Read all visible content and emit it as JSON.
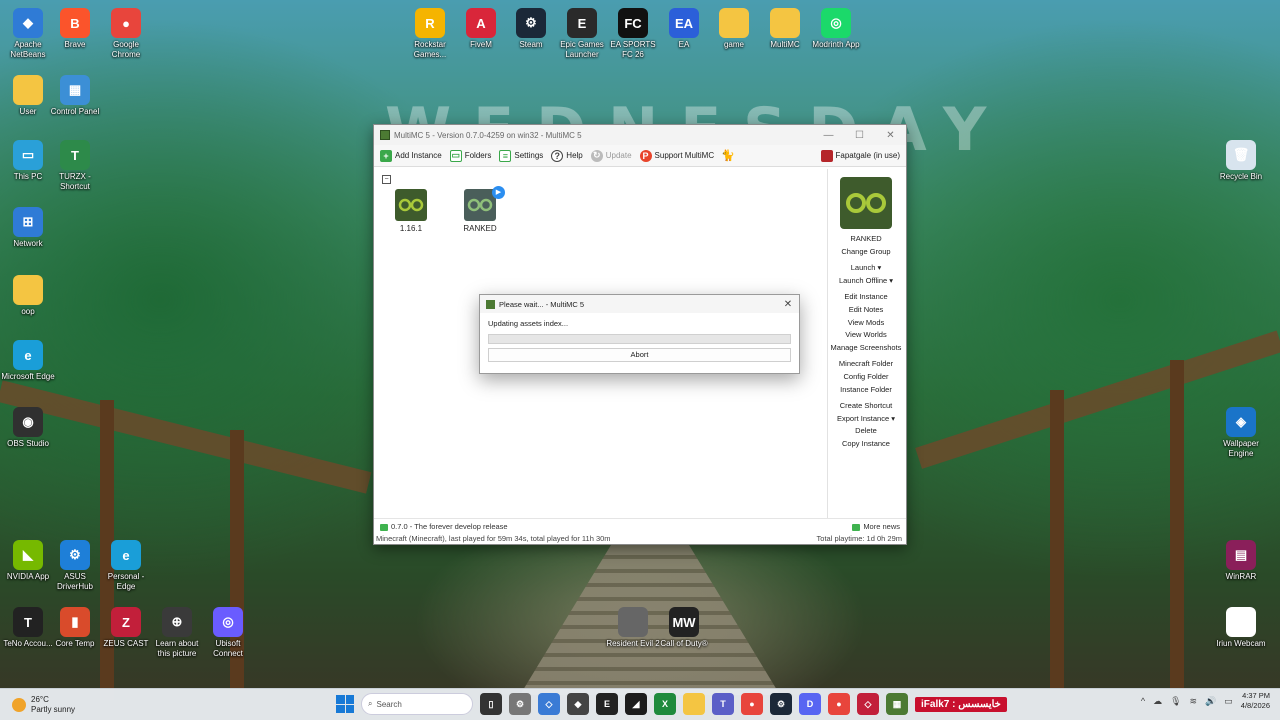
{
  "wallpaper": {
    "text": "WEDNESDAY"
  },
  "desktop_icons": [
    {
      "label": "Apache NetBeans",
      "color": "#2f7bd6",
      "glyph": "◆"
    },
    {
      "label": "Brave",
      "color": "#fb542b",
      "glyph": "B"
    },
    {
      "label": "Google Chrome",
      "color": "#e8453c",
      "glyph": "●"
    },
    {
      "label": "User",
      "color": "#f4c542",
      "glyph": ""
    },
    {
      "label": "Control Panel",
      "color": "#3c8fd6",
      "glyph": "▦"
    },
    {
      "label": "This PC",
      "color": "#2aa0d8",
      "glyph": "▭"
    },
    {
      "label": "TURZX - Shortcut",
      "color": "#2d8a4a",
      "glyph": "T"
    },
    {
      "label": "Network",
      "color": "#2f7bd6",
      "glyph": "⊞"
    },
    {
      "label": "oop",
      "color": "#f4c542",
      "glyph": ""
    },
    {
      "label": "Microsoft Edge",
      "color": "#1a9ed8",
      "glyph": "e"
    },
    {
      "label": "OBS Studio",
      "color": "#303030",
      "glyph": "◉"
    },
    {
      "label": "Rockstar Games...",
      "color": "#f5b400",
      "glyph": "R"
    },
    {
      "label": "FiveM",
      "color": "#d9263a",
      "glyph": "A"
    },
    {
      "label": "Steam",
      "color": "#1b2838",
      "glyph": "⚙"
    },
    {
      "label": "Epic Games Launcher",
      "color": "#2a2a2a",
      "glyph": "E"
    },
    {
      "label": "EA SPORTS FC 26",
      "color": "#111111",
      "glyph": "FC"
    },
    {
      "label": "EA",
      "color": "#2b5fd9",
      "glyph": "EA"
    },
    {
      "label": "game",
      "color": "#f4c542",
      "glyph": ""
    },
    {
      "label": "MultiMC",
      "color": "#f4c542",
      "glyph": ""
    },
    {
      "label": "Modrinth App",
      "color": "#1bd96a",
      "glyph": "◎"
    },
    {
      "label": "Recycle Bin",
      "color": "#d8e4ee",
      "glyph": "🗑"
    },
    {
      "label": "Wallpaper Engine",
      "color": "#1a74c9",
      "glyph": "◈"
    },
    {
      "label": "NVIDIA App",
      "color": "#76b900",
      "glyph": "◣"
    },
    {
      "label": "ASUS DriverHub",
      "color": "#1e7fd8",
      "glyph": "⚙"
    },
    {
      "label": "Personal - Edge",
      "color": "#1a9ed8",
      "glyph": "e"
    },
    {
      "label": "TeNo Accou...",
      "color": "#222222",
      "glyph": "T"
    },
    {
      "label": "Core Temp",
      "color": "#d94b2b",
      "glyph": "▮"
    },
    {
      "label": "ZEUS CAST",
      "color": "#c21f3a",
      "glyph": "Z"
    },
    {
      "label": "Learn about this picture",
      "color": "#3a3a3a",
      "glyph": "⊕"
    },
    {
      "label": "Ubisoft Connect",
      "color": "#6a5cff",
      "glyph": "◎"
    },
    {
      "label": "WinRAR",
      "color": "#8a1f5a",
      "glyph": "▤"
    },
    {
      "label": "Iriun Webcam",
      "color": "#ffffff",
      "glyph": "◯"
    },
    {
      "label": "Resident Evil 2",
      "color": "#666666",
      "glyph": ""
    },
    {
      "label": "Call of Duty®",
      "color": "#222222",
      "glyph": "MW"
    }
  ],
  "window": {
    "title": "MultiMC 5 - Version 0.7.0-4259 on win32 - MultiMC 5",
    "controls": [
      "—",
      "☐",
      "✕"
    ],
    "toolbar": {
      "add_instance": "Add Instance",
      "folders": "Folders",
      "settings": "Settings",
      "help": "Help",
      "update": "Update",
      "support": "Support MultiMC",
      "profile": "Fapatgale (in use)"
    },
    "group_toggle": "−",
    "instances": [
      {
        "name": "1.16.1"
      },
      {
        "name": "RANKED"
      }
    ],
    "side": {
      "instance_name": "RANKED",
      "change_group": "Change Group",
      "launch": "Launch",
      "launch_offline": "Launch Offline",
      "edit_instance": "Edit Instance",
      "edit_notes": "Edit Notes",
      "view_mods": "View Mods",
      "view_worlds": "View Worlds",
      "manage_screenshots": "Manage Screenshots",
      "minecraft_folder": "Minecraft Folder",
      "config_folder": "Config Folder",
      "instance_folder": "Instance Folder",
      "create_shortcut": "Create Shortcut",
      "export_instance": "Export Instance",
      "delete": "Delete",
      "copy_instance": "Copy Instance"
    },
    "news": "0.7.0 - The forever develop release",
    "more_news": "More news",
    "status_left": "Minecraft (Minecraft), last played for 59m 34s, total played for 11h 30m",
    "status_right": "Total playtime: 1d 0h 29m"
  },
  "dialog": {
    "title": "Please wait... - MultiMC 5",
    "message": "Updating assets index...",
    "progress": 0,
    "abort": "Abort"
  },
  "taskbar": {
    "temp": "26°C",
    "weather": "Partly sunny",
    "search_placeholder": "Search",
    "user_tag": "iFalk7 : خايسسس",
    "time": "4:37 PM",
    "date": "4/8/2026"
  }
}
